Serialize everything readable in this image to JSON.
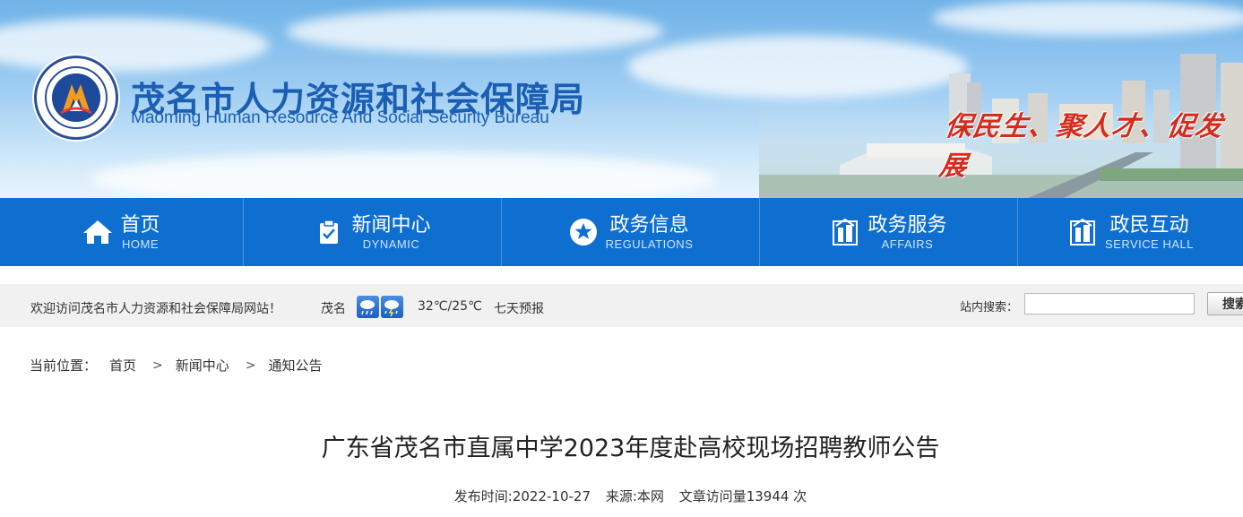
{
  "header": {
    "org_name_cn": "茂名市人力资源和社会保障局",
    "org_name_en": "Maoming Human Resource And Social Security Bureau",
    "seal_text": "茂名市人力资源和社会保障局",
    "slogan": "保民生、聚人才、促发展"
  },
  "nav": {
    "items": [
      {
        "label": "首页",
        "sub": "HOME",
        "icon": "home-icon"
      },
      {
        "label": "新闻中心",
        "sub": "DYNAMIC",
        "icon": "clipboard-check-icon"
      },
      {
        "label": "政务信息",
        "sub": "REGULATIONS",
        "icon": "star-icon"
      },
      {
        "label": "政务服务",
        "sub": "AFFAIRS",
        "icon": "building-icon"
      },
      {
        "label": "政民互动",
        "sub": "SERVICE HALL",
        "icon": "building-icon"
      }
    ]
  },
  "infobar": {
    "welcome": "欢迎访问茂名市人力资源和社会保障局网站！",
    "city": "茂名",
    "weather_icons": [
      "rain-icon",
      "thunder-rain-icon"
    ],
    "temperature": "32℃/25℃",
    "forecast_link": "七天预报",
    "search_label": "站内搜索：",
    "search_value": "",
    "search_button": "搜索"
  },
  "breadcrumb": {
    "prefix": "当前位置：",
    "items": [
      "首页",
      "新闻中心",
      "通知公告"
    ],
    "separator": ">"
  },
  "article": {
    "title": "广东省茂名市直属中学2023年度赴高校现场招聘教师公告",
    "publish_label": "发布时间:",
    "publish_date": "2022-10-27",
    "source_label": "来源:",
    "source": "本网",
    "views_label": "文章访问量",
    "views": "13944",
    "views_unit": "次"
  },
  "colors": {
    "nav_blue": "#0e6fd1",
    "title_blue": "#1a5fb4",
    "slogan_red": "#d42d1e"
  }
}
